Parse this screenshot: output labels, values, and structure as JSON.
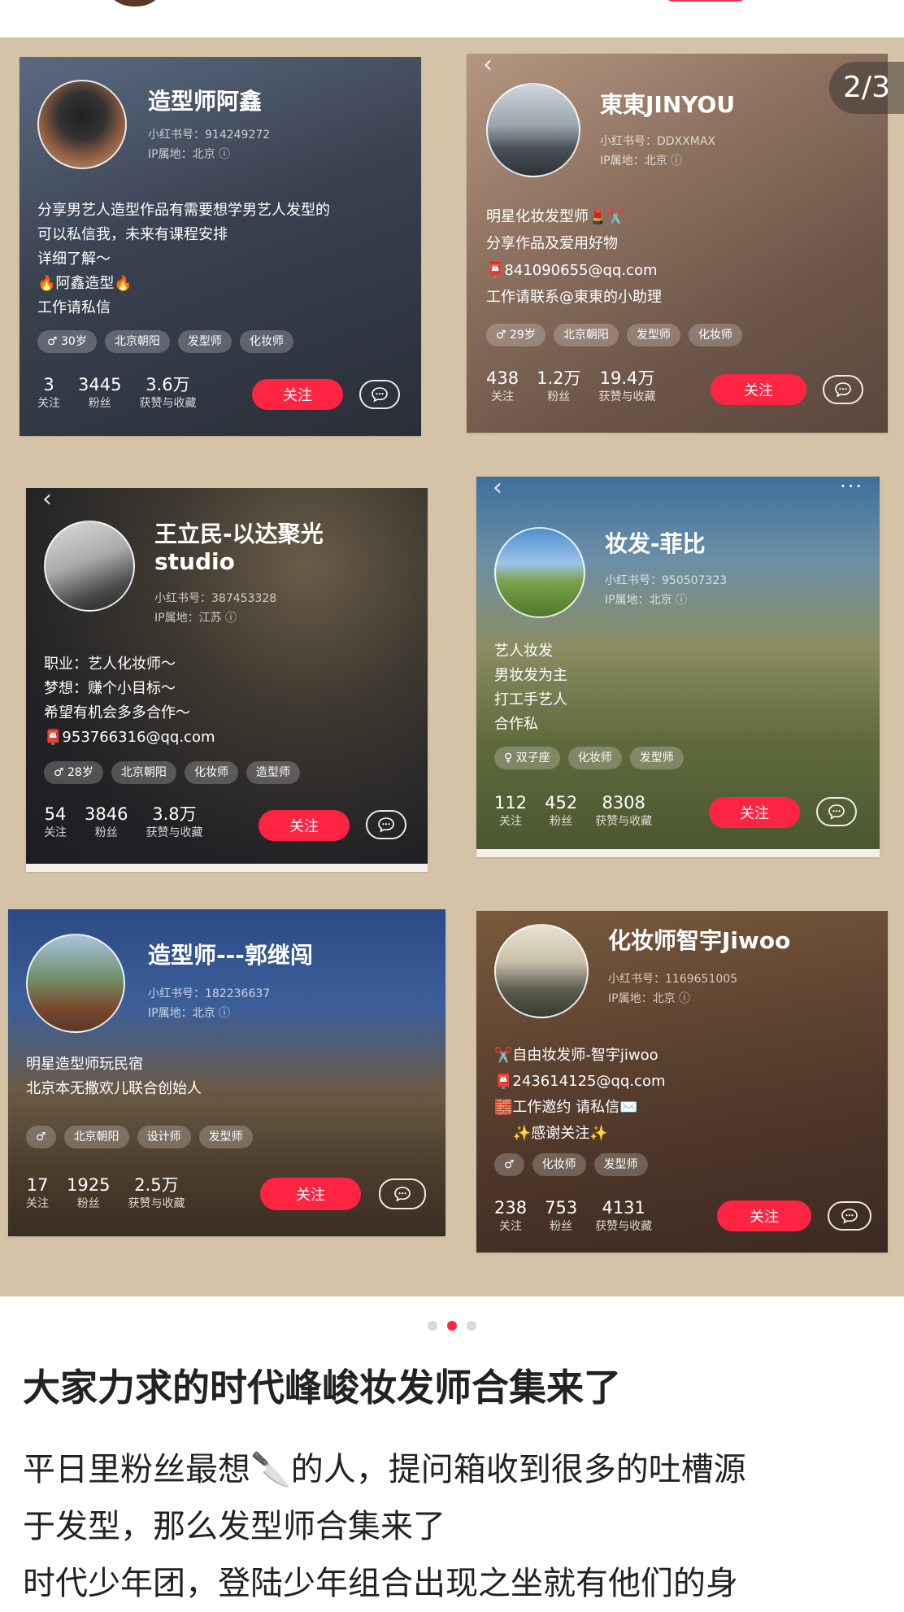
{
  "page_badge": "2/3",
  "cards": [
    {
      "name": "造型师阿鑫",
      "xhs_id": "小红书号：914249272",
      "ip": "IP属地：北京 ⓘ",
      "bio": "分享男艺人造型作品有需要想学男艺人发型的\n可以私信我，未来有课程安排\n详细了解～\n🔥阿鑫造型🔥\n工作请私信",
      "tags": [
        "♂ 30岁",
        "北京朝阳",
        "发型师",
        "化妆师"
      ],
      "stats": [
        {
          "num": "3",
          "label": "关注"
        },
        {
          "num": "3445",
          "label": "粉丝"
        },
        {
          "num": "3.6万",
          "label": "获赞与收藏"
        }
      ],
      "follow_label": "关注"
    },
    {
      "name": "東東JINYOU",
      "xhs_id": "小红书号：DDXXMAX",
      "ip": "IP属地：北京 ⓘ",
      "bio": "明星化妆发型师💄✂️\n分享作品及爱用好物\n📮841090655@qq.com\n工作请联系@東東的小助理",
      "tags": [
        "♂ 29岁",
        "北京朝阳",
        "发型师",
        "化妆师"
      ],
      "stats": [
        {
          "num": "438",
          "label": "关注"
        },
        {
          "num": "1.2万",
          "label": "粉丝"
        },
        {
          "num": "19.4万",
          "label": "获赞与收藏"
        }
      ],
      "follow_label": "关注"
    },
    {
      "name": "王立民-以达聚光\nstudio",
      "xhs_id": "小红书号：387453328",
      "ip": "IP属地：江苏 ⓘ",
      "bio": "职业：艺人化妆师～\n梦想：赚个小目标～\n希望有机会多多合作～\n📮953766316@qq.com",
      "tags": [
        "♂ 28岁",
        "北京朝阳",
        "化妆师",
        "造型师"
      ],
      "stats": [
        {
          "num": "54",
          "label": "关注"
        },
        {
          "num": "3846",
          "label": "粉丝"
        },
        {
          "num": "3.8万",
          "label": "获赞与收藏"
        }
      ],
      "follow_label": "关注"
    },
    {
      "name": "妆发-菲比",
      "xhs_id": "小红书号：950507323",
      "ip": "IP属地：北京 ⓘ",
      "bio": "艺人妆发\n男妆发为主\n打工手艺人\n合作私",
      "tags": [
        "♀ 双子座",
        "化妆师",
        "发型师"
      ],
      "stats": [
        {
          "num": "112",
          "label": "关注"
        },
        {
          "num": "452",
          "label": "粉丝"
        },
        {
          "num": "8308",
          "label": "获赞与收藏"
        }
      ],
      "follow_label": "关注"
    },
    {
      "name": "造型师---郭继闯",
      "xhs_id": "小红书号：182236637",
      "ip": "IP属地：北京 ⓘ",
      "bio": "明星造型师玩民宿\n北京本无撒欢儿联合创始人",
      "tags": [
        "♂",
        "北京朝阳",
        "设计师",
        "发型师"
      ],
      "stats": [
        {
          "num": "17",
          "label": "关注"
        },
        {
          "num": "1925",
          "label": "粉丝"
        },
        {
          "num": "2.5万",
          "label": "获赞与收藏"
        }
      ],
      "follow_label": "关注"
    },
    {
      "name": "化妆师智宇Jiwoo",
      "xhs_id": "小红书号：1169651005",
      "ip": "IP属地：北京 ⓘ",
      "bio": "✂️自由妆发师-智宇jiwoo\n📮243614125@qq.com\n🧱工作邀约 请私信✉️\n    ✨感谢关注✨",
      "tags": [
        "♂",
        "化妆师",
        "发型师"
      ],
      "stats": [
        {
          "num": "238",
          "label": "关注"
        },
        {
          "num": "753",
          "label": "粉丝"
        },
        {
          "num": "4131",
          "label": "获赞与收藏"
        }
      ],
      "follow_label": "关注"
    }
  ],
  "post": {
    "title": "大家力求的时代峰峻妆发师合集来了",
    "body_line1": "平日里粉丝最想🔪的人，提问箱收到很多的吐槽源",
    "body_line2": "于发型，那么发型师合集来了",
    "body_line3": "时代少年团，登陆少年组合出现之坐就有他们的身"
  },
  "colors": {
    "accent": "#ff2442",
    "carousel_bg": "#d4c3a7"
  },
  "icons": [
    "back-arrow-icon",
    "more-icon",
    "message-icon"
  ]
}
